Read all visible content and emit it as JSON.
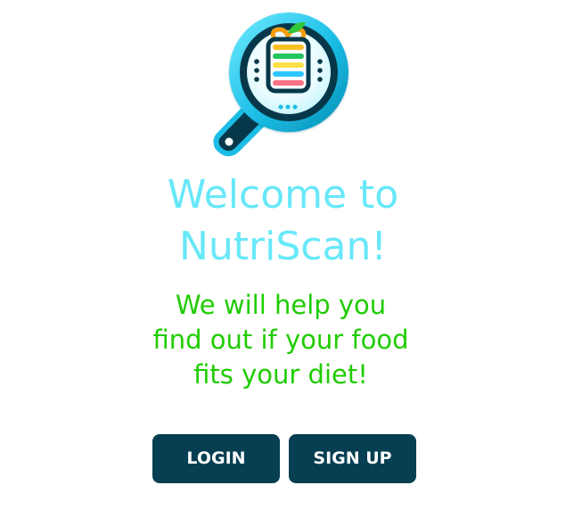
{
  "welcome": {
    "title_line_1": "Welcome to",
    "title_line_2": "NutriScan!",
    "tagline_line_1": "We will help you",
    "tagline_line_2": "find out if your food",
    "tagline_line_3": "fits your diet!"
  },
  "actions": {
    "login_label": "LOGIN",
    "signup_label": "SIGN UP"
  },
  "logo": {
    "icon": "magnifying-glass-food-label-icon"
  },
  "colors": {
    "title": "#67e8f9",
    "tagline": "#1fcc00",
    "button_background": "#063f51",
    "button_text": "#ffffff",
    "logo_ring": "#1bbde6",
    "logo_handle": "#07384a"
  }
}
